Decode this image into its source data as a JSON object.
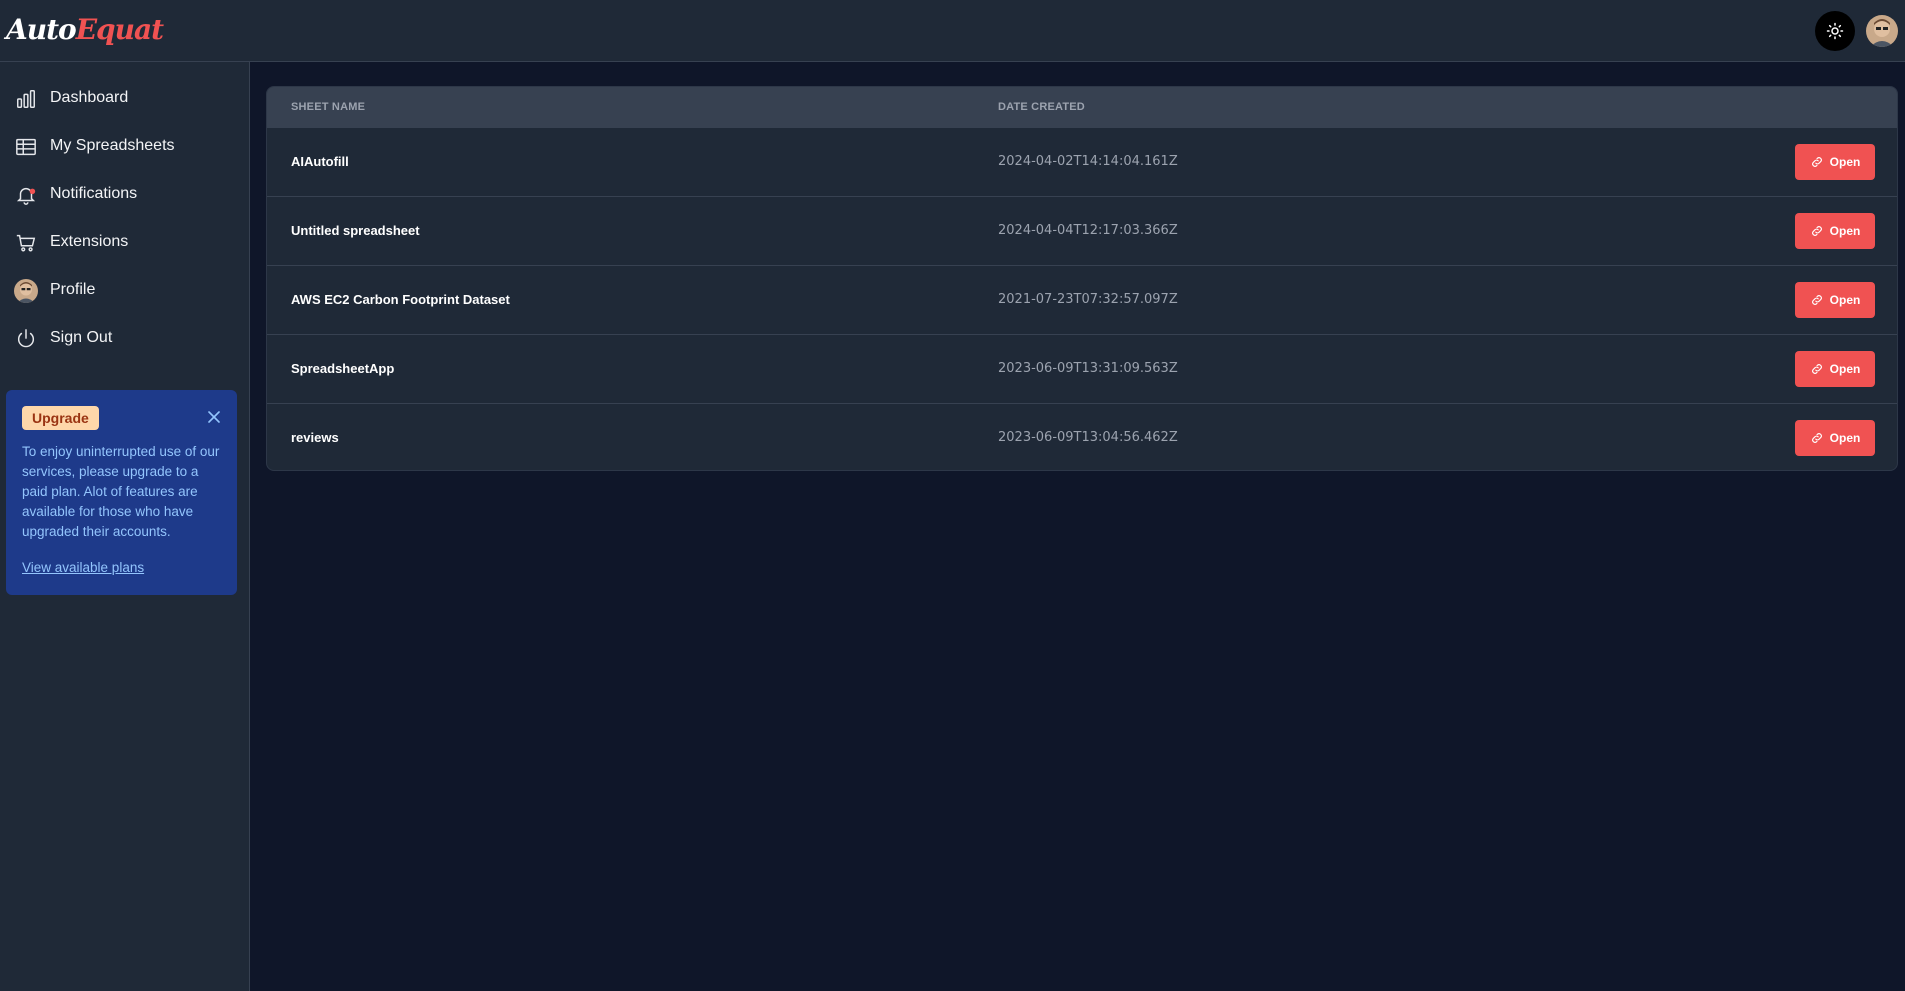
{
  "app": {
    "logo_part1": "Auto",
    "logo_part2": "Equat"
  },
  "sidebar": {
    "items": [
      {
        "label": "Dashboard",
        "icon": "chart-bar-icon"
      },
      {
        "label": "My Spreadsheets",
        "icon": "table-icon"
      },
      {
        "label": "Notifications",
        "icon": "bell-icon"
      },
      {
        "label": "Extensions",
        "icon": "cart-icon"
      },
      {
        "label": "Profile",
        "icon": "avatar"
      },
      {
        "label": "Sign Out",
        "icon": "power-icon"
      }
    ]
  },
  "upgrade": {
    "badge": "Upgrade",
    "text": "To enjoy uninterrupted use of our services, please upgrade to a paid plan. Alot of features are available for those who have upgraded their accounts.",
    "link": "View available plans"
  },
  "table": {
    "headers": [
      "SHEET NAME",
      "DATE CREATED"
    ],
    "open_label": "Open",
    "rows": [
      {
        "name": "AIAutofill",
        "date": "2024-04-02T14:14:04.161Z"
      },
      {
        "name": "Untitled spreadsheet",
        "date": "2024-04-04T12:17:03.366Z"
      },
      {
        "name": "AWS EC2 Carbon Footprint Dataset",
        "date": "2021-07-23T07:32:57.097Z"
      },
      {
        "name": "SpreadsheetApp",
        "date": "2023-06-09T13:31:09.563Z"
      },
      {
        "name": "reviews",
        "date": "2023-06-09T13:04:56.462Z"
      }
    ]
  },
  "colors": {
    "accent": "#f05252",
    "sidebar_bg": "#1f2937",
    "page_bg": "#0f1629",
    "upgrade_bg": "#1e3a8a"
  }
}
